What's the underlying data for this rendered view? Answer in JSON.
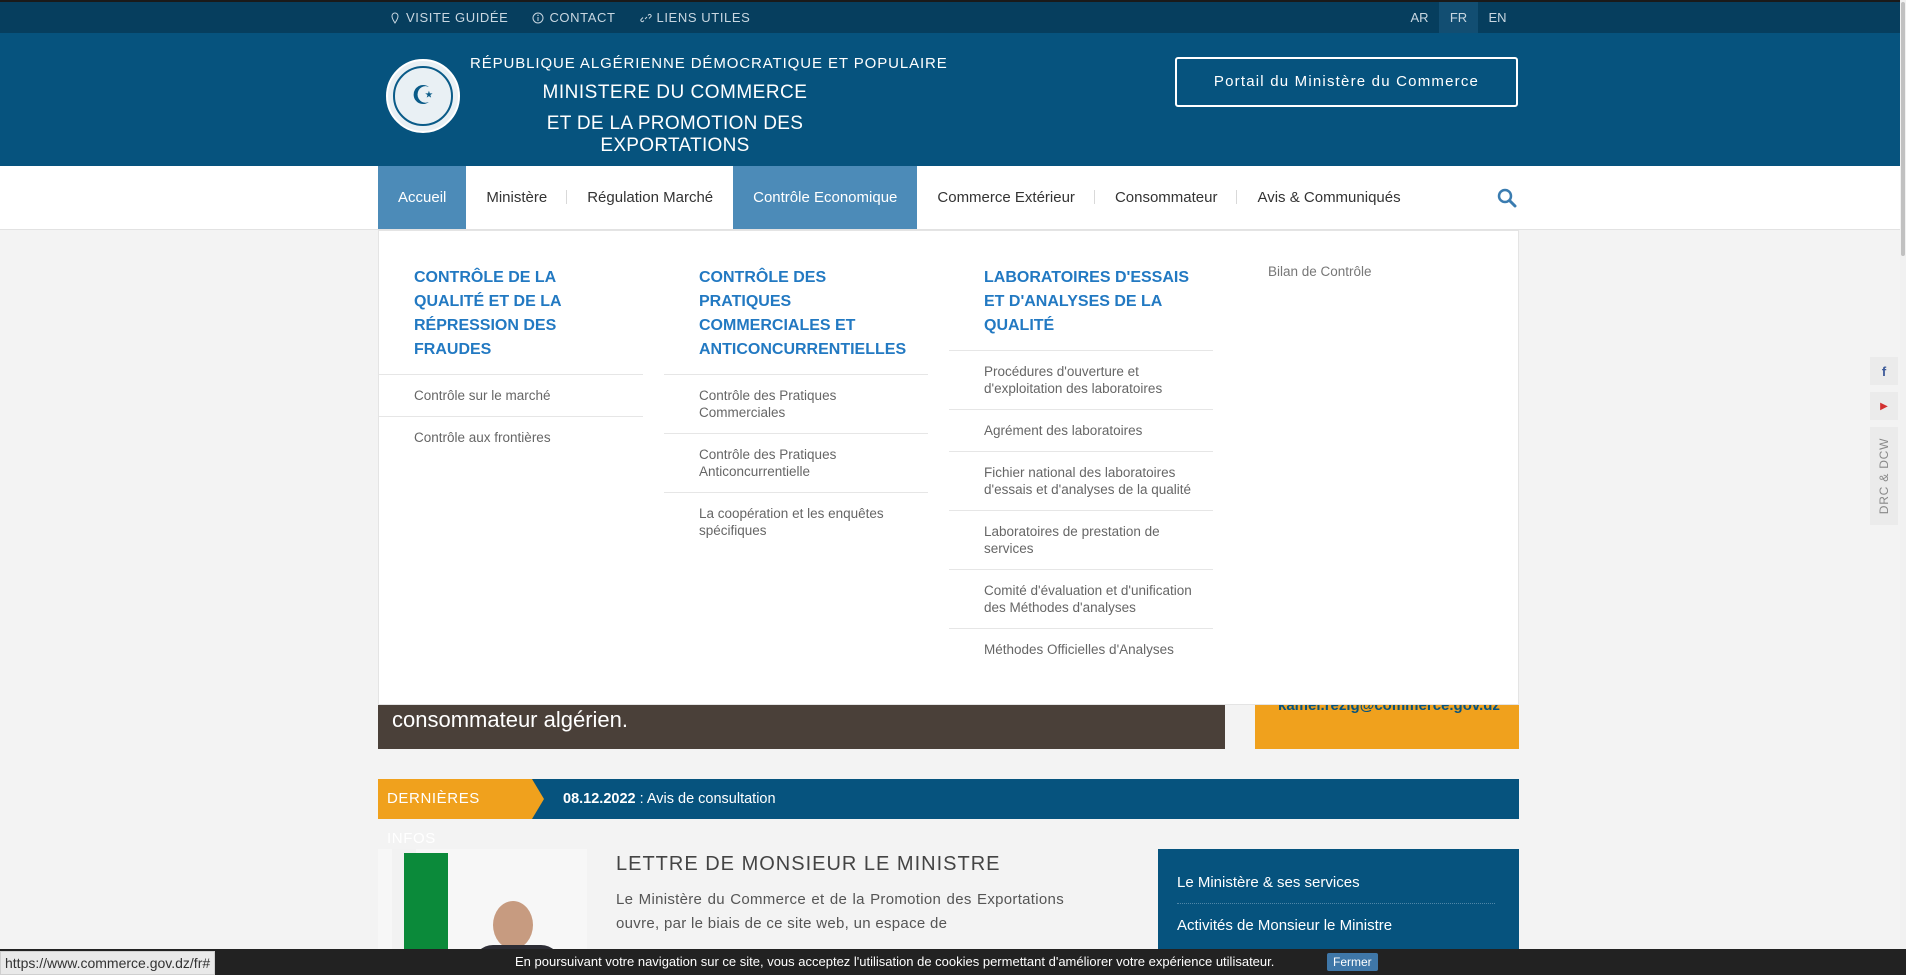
{
  "topbar": {
    "links": [
      {
        "label": "VISITE GUIDÉE",
        "icon": "map-pin-icon"
      },
      {
        "label": "CONTACT",
        "icon": "info-icon"
      },
      {
        "label": "LIENS UTILES",
        "icon": "link-icon"
      }
    ],
    "languages": [
      "AR",
      "FR",
      "EN"
    ],
    "active_language": "FR"
  },
  "header": {
    "republic": "RÉPUBLIQUE ALGÉRIENNE DÉMOCRATIQUE ET POPULAIRE",
    "ministry_line1": "MINISTERE DU COMMERCE",
    "ministry_line2": "ET DE  LA PROMOTION DES EXPORTATIONS",
    "portal_button": "Portail du Ministère du Commerce"
  },
  "nav": {
    "items": [
      "Accueil",
      "Ministère",
      "Régulation Marché",
      "Contrôle Economique",
      "Commerce Extérieur",
      "Consommateur",
      "Avis & Communiqués"
    ],
    "search_icon": "search-icon"
  },
  "dropdown": {
    "col1": {
      "title": "CONTRÔLE DE LA QUALITÉ ET DE LA RÉPRESSION DES FRAUDES",
      "items": [
        "Contrôle sur le marché",
        "Contrôle aux frontières"
      ]
    },
    "col2": {
      "title": "CONTRÔLE DES PRATIQUES COMMERCIALES ET ANTICONCURRENTIELLES",
      "items": [
        "Contrôle des Pratiques Commerciales",
        "Contrôle des Pratiques Anticoncurrentielle",
        "La coopération et les enquêtes spécifiques"
      ]
    },
    "col3": {
      "title": "LABORATOIRES D'ESSAIS ET D'ANALYSES DE LA QUALITÉ",
      "items": [
        "Procédures d'ouverture et d'exploitation des laboratoires",
        "Agrément des laboratoires",
        "Fichier national des laboratoires d'essais et d'analyses de la qualité",
        "Laboratoires de prestation de services",
        "Comité d'évaluation et d'unification des Méthodes d'analyses",
        "Méthodes Officielles d'Analyses"
      ]
    },
    "col4": {
      "item": "Bilan de Contrôle"
    }
  },
  "slider": {
    "text": "consommateur algérien.",
    "email": "kamel.rezig@commerce.gov.dz"
  },
  "ticker": {
    "label": "DERNIÈRES INFOS",
    "date": "08.12.2022",
    "text": " : Avis de consultation"
  },
  "letter": {
    "title": "LETTRE DE MONSIEUR LE MINISTRE",
    "text": "Le Ministère du Commerce et de la Promotion des Exportations ouvre, par le biais de ce site web, un espace de"
  },
  "sidebox": {
    "items": [
      "Le Ministère & ses services",
      "Activités de Monsieur le Ministre"
    ]
  },
  "social": {
    "facebook": "f",
    "youtube": "▶",
    "drc_label": "DRC & DCW"
  },
  "status_url": "https://www.commerce.gov.dz/fr#",
  "cookie": {
    "message": "En poursuivant votre navigation sur ce site, vous acceptez l'utilisation de cookies permettant d'améliorer votre expérience utilisateur.",
    "button": "Fermer"
  },
  "colors": {
    "primary": "#06537e",
    "accent": "#f0a11d",
    "nav_active": "#4c8bb8",
    "dropdown_title": "#2279c2"
  }
}
